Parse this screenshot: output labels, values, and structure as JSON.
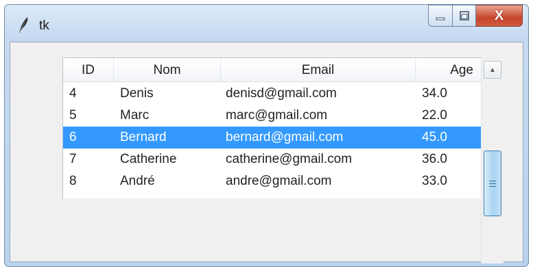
{
  "window": {
    "title": "tk",
    "icon": "feather-icon",
    "controls": {
      "minimize": "minimize-icon",
      "maximize": "maximize-icon",
      "close_label": "X"
    }
  },
  "table": {
    "columns": [
      "ID",
      "Nom",
      "Email",
      "Age"
    ],
    "rows": [
      {
        "id": "4",
        "nom": "Denis",
        "email": "denisd@gmail.com",
        "age": "34.0",
        "selected": false
      },
      {
        "id": "5",
        "nom": "Marc",
        "email": "marc@gmail.com",
        "age": "22.0",
        "selected": false
      },
      {
        "id": "6",
        "nom": "Bernard",
        "email": "bernard@gmail.com",
        "age": "45.0",
        "selected": true
      },
      {
        "id": "7",
        "nom": "Catherine",
        "email": "catherine@gmail.com",
        "age": "36.0",
        "selected": false
      },
      {
        "id": "8",
        "nom": "André",
        "email": "andre@gmail.com",
        "age": "33.0",
        "selected": false
      }
    ]
  },
  "colors": {
    "selection": "#3399ff",
    "close_button": "#c8462d"
  }
}
